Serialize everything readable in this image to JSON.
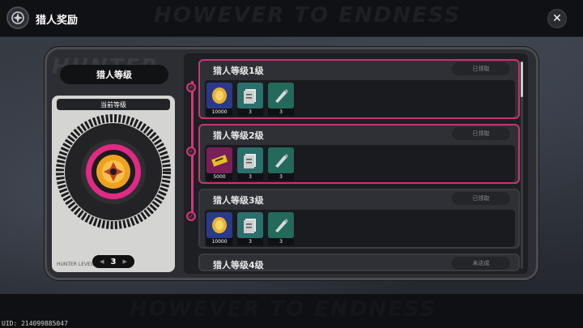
{
  "header": {
    "title": "猎人奖励",
    "watermark": "HOWEVER TO ENDNESS"
  },
  "footer": {
    "uid": "UID: 214099885047",
    "watermark": "HOWEVER TO ENDNESS"
  },
  "left": {
    "background_text": "HUNTER",
    "title": "猎人等级",
    "card_label": "当前等级",
    "level": "3",
    "card_caption": "HUNTER LEVEL"
  },
  "rows": [
    {
      "title": "猎人等级1级",
      "status": "已领取",
      "items": [
        {
          "icon": "gold-coin-icon",
          "count": "10000",
          "color": "#2a3a8a"
        },
        {
          "icon": "document-icon",
          "count": "3",
          "color": "#2a6f6b"
        },
        {
          "icon": "tool-icon",
          "count": "3",
          "color": "#23695c"
        }
      ]
    },
    {
      "title": "猎人等级2级",
      "status": "已领取",
      "items": [
        {
          "icon": "ticket-icon",
          "count": "5000",
          "color": "#7a1f5a"
        },
        {
          "icon": "document-icon",
          "count": "3",
          "color": "#2a6f6b"
        },
        {
          "icon": "tool-icon",
          "count": "3",
          "color": "#23695c"
        }
      ]
    },
    {
      "title": "猎人等级3级",
      "status": "已领取",
      "items": [
        {
          "icon": "gold-coin-icon",
          "count": "10000",
          "color": "#2a3a8a"
        },
        {
          "icon": "document-icon",
          "count": "3",
          "color": "#2a6f6b"
        },
        {
          "icon": "tool-icon",
          "count": "3",
          "color": "#23695c"
        }
      ]
    },
    {
      "title": "猎人等级4级",
      "status": "未达成"
    }
  ],
  "colors": {
    "accent": "#e0307a",
    "panel": "#2e3035"
  }
}
